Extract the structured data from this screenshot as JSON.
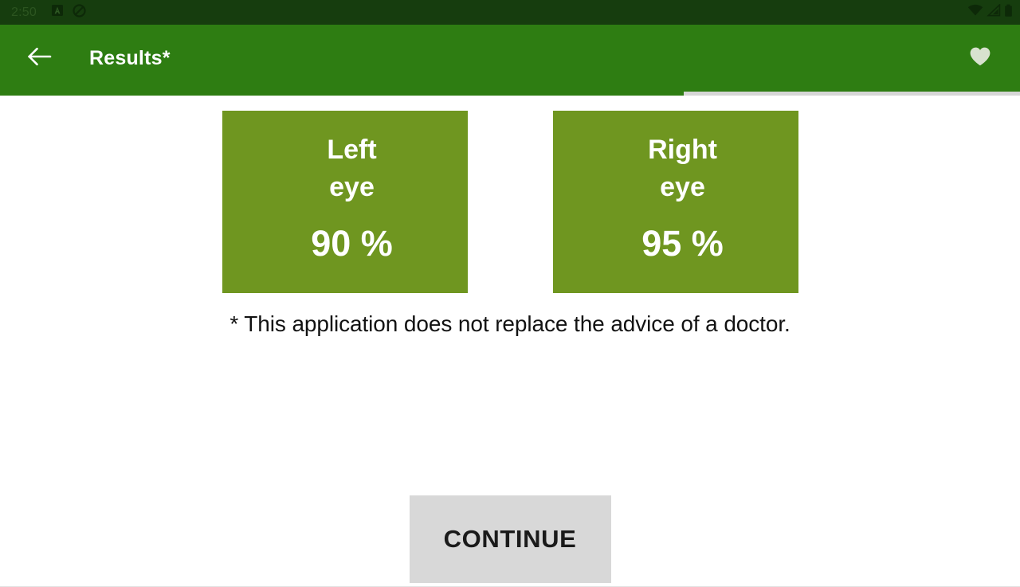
{
  "status_bar": {
    "clock": "2:50",
    "left_icons": [
      "app-notification-icon",
      "do-not-disturb-icon"
    ],
    "right_icons": [
      "wifi-icon",
      "cellular-signal-icon",
      "battery-icon"
    ],
    "background_color": "#163d0e"
  },
  "app_bar": {
    "back_label": "back-arrow-icon",
    "title": "Results*",
    "favorite_label": "heart-icon",
    "background_color": "#2e7d12",
    "title_color": "#ffffff"
  },
  "progress": {
    "percent": 67,
    "fill_color": "#2e7d12",
    "track_color": "#d6d6d6"
  },
  "main": {
    "cards": [
      {
        "name": "left-eye",
        "title_line1": "Left",
        "title_line2": "eye",
        "value": "90 %",
        "color": "#6f9620"
      },
      {
        "name": "right-eye",
        "title_line1": "Right",
        "title_line2": "eye",
        "value": "95 %",
        "color": "#6f9620"
      }
    ],
    "disclaimer": "* This application does not replace the advice of a doctor.",
    "continue_label": "CONTINUE",
    "continue_color": "#d8d8d8"
  }
}
